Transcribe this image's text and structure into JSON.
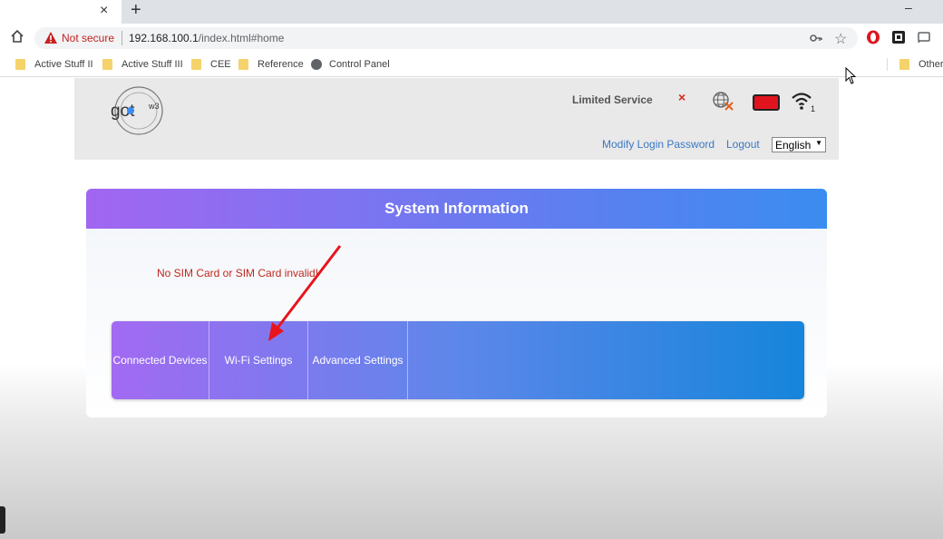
{
  "browser": {
    "tab_close": "×",
    "new_tab": "+",
    "minimize": "–",
    "not_secure": "Not secure",
    "url_host": "192.168.100.1",
    "url_path": "/index.html#home",
    "bookmarks": [
      "Active Stuff II",
      "Active Stuff III",
      "CEE",
      "Reference",
      "Control Panel",
      "Other"
    ]
  },
  "router": {
    "status": "Limited Service",
    "status_x": "×",
    "modify_password": "Modify Login Password",
    "logout": "Logout",
    "language": "English",
    "wifi_count": "1",
    "panel_title": "System Information",
    "sim_message": "No SIM Card or SIM Card invalid!",
    "menu": [
      "Connected Devices",
      "Wi-Fi Settings",
      "Advanced Settings"
    ]
  },
  "colors": {
    "accent_start": "#a266f1",
    "accent_end": "#3a8cf0",
    "error": "#c0281f",
    "link": "#3b78c2",
    "annotation_arrow": "#e8141c"
  },
  "icons": [
    "home-icon",
    "warning-icon",
    "key-icon",
    "star-icon",
    "opera-icon",
    "extension-icon",
    "cast-icon",
    "folder-icon",
    "globe-icon",
    "no-internet-icon",
    "sim-card-icon",
    "wifi-icon",
    "mouse-cursor-icon"
  ]
}
